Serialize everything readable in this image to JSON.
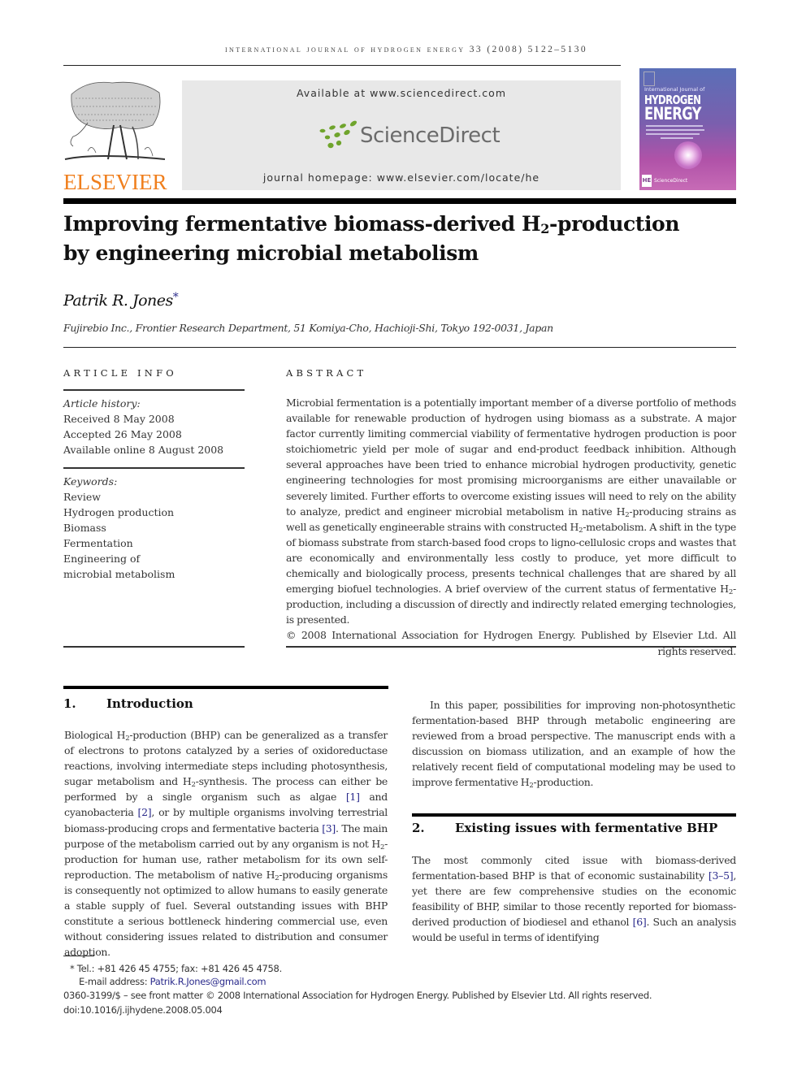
{
  "running_header": "International Journal of Hydrogen Energy 33 (2008) 5122–5130",
  "publisher": {
    "logo_wordmark": "ELSEVIER",
    "brand_color": "#f07f1d"
  },
  "sciencedirect_box": {
    "available_at": "Available at www.sciencedirect.com",
    "logo_wordmark": "ScienceDirect",
    "logo_color": "#6fa42c",
    "homepage": "journal homepage: www.elsevier.com/locate/he"
  },
  "journal_cover": {
    "subtitle": "International Journal of",
    "title_line1": "HYDROGEN",
    "title_line2": "ENERGY",
    "footer_logo": "ScienceDirect",
    "badge": "HE"
  },
  "article": {
    "title_part1": "Improving fermentative biomass-derived H",
    "title_sub": "2",
    "title_part2": "-production",
    "title_line2": "by engineering microbial metabolism",
    "author": "Patrik R. Jones",
    "author_mark": "*",
    "affiliation": "Fujirebio Inc., Frontier Research Department, 51 Komiya-Cho, Hachioji-Shi, Tokyo 192-0031, Japan"
  },
  "article_info": {
    "heading": "ARTICLE INFO",
    "history_label": "Article history:",
    "received": "Received 8 May 2008",
    "accepted": "Accepted 26 May 2008",
    "online": "Available online 8 August 2008",
    "keywords_label": "Keywords:",
    "keywords": [
      "Review",
      "Hydrogen production",
      "Biomass",
      "Fermentation",
      "Engineering of",
      "microbial metabolism"
    ]
  },
  "abstract": {
    "heading": "ABSTRACT",
    "p1": "Microbial fermentation is a potentially important member of a diverse portfolio of methods available for renewable production of hydrogen using biomass as a substrate. A major factor currently limiting commercial viability of fermentative hydrogen production is poor stoichiometric yield per mole of sugar and end-product feedback inhibition. Although several approaches have been tried to enhance microbial hydrogen productivity, genetic engineering technologies for most promising microorganisms are either unavailable or severely limited. Further efforts to overcome existing issues will need to rely on the ability to analyze, predict and engineer microbial metabolism in native H",
    "p2": "-producing strains as well as genetically engineerable strains with constructed H",
    "p3": "-metabolism. A shift in the type of biomass substrate from starch-based food crops to ligno-cellulosic crops and wastes that are economically and environmentally less costly to produce, yet more difficult to chemically and biologically process, presents technical challenges that are shared by all emerging biofuel technologies. A brief overview of the current status of fermentative H",
    "p4": "-production, including a discussion of directly and indirectly related emerging technologies, is presented.",
    "copyright": "© 2008 International Association for Hydrogen Energy. Published by Elsevier Ltd. All rights reserved.",
    "sub": "2"
  },
  "sections": {
    "intro": {
      "number": "1.",
      "title": "Introduction",
      "s1": "Biological H",
      "s2": "-production (BHP) can be generalized as a transfer of electrons to protons catalyzed by a series of oxidoreductase reactions, involving intermediate steps including photosynthesis, sugar metabolism and H",
      "s3": "-synthesis. The process can either be performed by a single organism such as algae ",
      "ref1": "[1]",
      "s4": " and cyanobacteria ",
      "ref2": "[2]",
      "s5": ", or by multiple organisms involving terrestrial biomass-producing crops and fermentative bacteria ",
      "ref3": "[3]",
      "s6": ". The main purpose of the metabolism carried out by any organism is not H",
      "s7": "-production for human use, rather metabolism for its own self-reproduction. The metabolism of native H",
      "s8": "-producing organisms is consequently not optimized to allow humans to easily generate a stable supply of fuel. Several outstanding issues with BHP constitute a serious bottleneck hindering commercial use, even without considering issues related to distribution and consumer adoption.",
      "p2_a": "In this paper, possibilities for improving non-photosynthetic fermentation-based BHP through metabolic engineering are reviewed from a broad perspective. The manuscript ends with a discussion on biomass utilization, and an example of how the relatively recent field of computational modeling may be used to improve fermentative H",
      "p2_b": "-production.",
      "sub": "2"
    },
    "issues": {
      "number": "2.",
      "title": "Existing issues with fermentative BHP",
      "s1": "The most commonly cited issue with biomass-derived fermentation-based BHP is that of economic sustainability ",
      "ref1": "[3–5]",
      "s2": ", yet there are few comprehensive studies on the economic feasibility of BHP, similar to those recently reported for biomass-derived production of biodiesel and ethanol ",
      "ref2": "[6]",
      "s3": ". Such an analysis would be useful in terms of identifying"
    }
  },
  "footnotes": {
    "tel": "* Tel.: +81 426 45 4755; fax: +81 426 45 4758.",
    "email_label": "E-mail address: ",
    "email": "Patrik.R.Jones@gmail.com",
    "front_matter": "0360-3199/$ – see front matter © 2008 International Association for Hydrogen Energy. Published by Elsevier Ltd. All rights reserved.",
    "doi": "doi:10.1016/j.ijhydene.2008.05.004"
  }
}
